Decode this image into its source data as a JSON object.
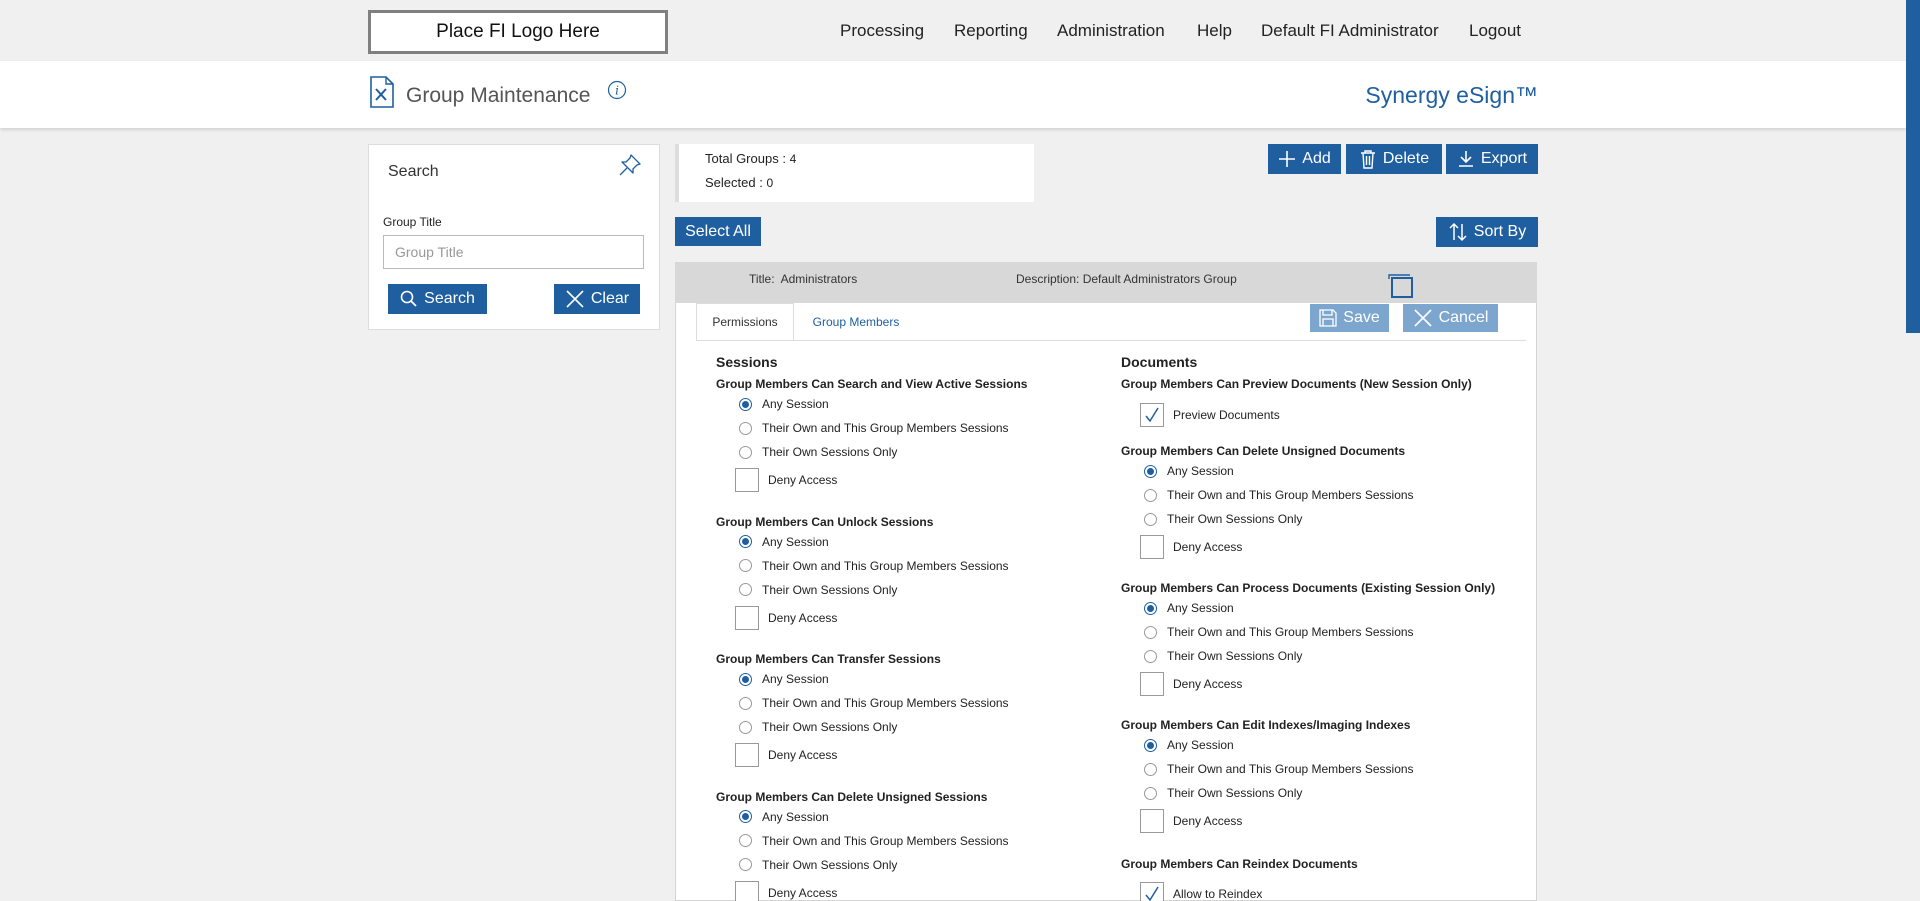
{
  "header": {
    "logo_text": "Place FI Logo Here",
    "nav": [
      "Processing",
      "Reporting",
      "Administration",
      "Help",
      "Default FI Administrator",
      "Logout"
    ]
  },
  "subheader": {
    "title": "Group Maintenance",
    "brand": "Synergy eSign™"
  },
  "search_panel": {
    "title": "Search",
    "field_label": "Group Title",
    "field_placeholder": "Group Title",
    "field_value": "",
    "search_label": "Search",
    "clear_label": "Clear"
  },
  "summary": {
    "total_label": "Total Groups :",
    "total_value": "4",
    "selected_label": "Selected :",
    "selected_value": "0"
  },
  "toolbar": {
    "add_label": "Add",
    "delete_label": "Delete",
    "export_label": "Export",
    "select_all_label": "Select All",
    "sort_label": "Sort By"
  },
  "group": {
    "title_label": "Title:",
    "title_value": "Administrators",
    "description_label": "Description:",
    "description_value": "Default Administrators Group",
    "selected": false,
    "save_label": "Save",
    "cancel_label": "Cancel",
    "tabs": [
      "Permissions",
      "Group Members"
    ],
    "active_tab": "Permissions"
  },
  "permissions": {
    "sessions": {
      "heading": "Sessions",
      "items": [
        {
          "title": "Group Members Can Search and View Active Sessions",
          "options": [
            "Any Session",
            "Their Own and This Group Members Sessions",
            "Their Own Sessions Only"
          ],
          "selected": 0,
          "deny_label": "Deny Access",
          "deny": false
        },
        {
          "title": "Group Members Can Unlock Sessions",
          "options": [
            "Any Session",
            "Their Own and This Group Members Sessions",
            "Their Own Sessions Only"
          ],
          "selected": 0,
          "deny_label": "Deny Access",
          "deny": false
        },
        {
          "title": "Group Members Can Transfer Sessions",
          "options": [
            "Any Session",
            "Their Own and This Group Members Sessions",
            "Their Own Sessions Only"
          ],
          "selected": 0,
          "deny_label": "Deny Access",
          "deny": false
        },
        {
          "title": "Group Members Can Delete Unsigned Sessions",
          "options": [
            "Any Session",
            "Their Own and This Group Members Sessions",
            "Their Own Sessions Only"
          ],
          "selected": 0,
          "deny_label": "Deny Access",
          "deny": false
        }
      ]
    },
    "documents": {
      "heading": "Documents",
      "preview_title": "Group Members Can Preview Documents (New Session Only)",
      "preview_label": "Preview Documents",
      "preview_checked": true,
      "items": [
        {
          "title": "Group Members Can Delete Unsigned Documents",
          "options": [
            "Any Session",
            "Their Own and This Group Members Sessions",
            "Their Own Sessions Only"
          ],
          "selected": 0,
          "deny_label": "Deny Access",
          "deny": false
        },
        {
          "title": "Group Members Can Process Documents (Existing Session Only)",
          "options": [
            "Any Session",
            "Their Own and This Group Members Sessions",
            "Their Own Sessions Only"
          ],
          "selected": 0,
          "deny_label": "Deny Access",
          "deny": false
        },
        {
          "title": "Group Members Can Edit Indexes/Imaging Indexes",
          "options": [
            "Any Session",
            "Their Own and This Group Members Sessions",
            "Their Own Sessions Only"
          ],
          "selected": 0,
          "deny_label": "Deny Access",
          "deny": false
        }
      ],
      "reindex_title": "Group Members Can Reindex Documents",
      "reindex_label": "Allow to Reindex",
      "reindex_checked": true
    }
  },
  "colors": {
    "accent": "#1f5fa0",
    "accent_light": "#7da6cf",
    "page_bg": "#f0f0f0",
    "card_header": "#d8d8d8"
  }
}
